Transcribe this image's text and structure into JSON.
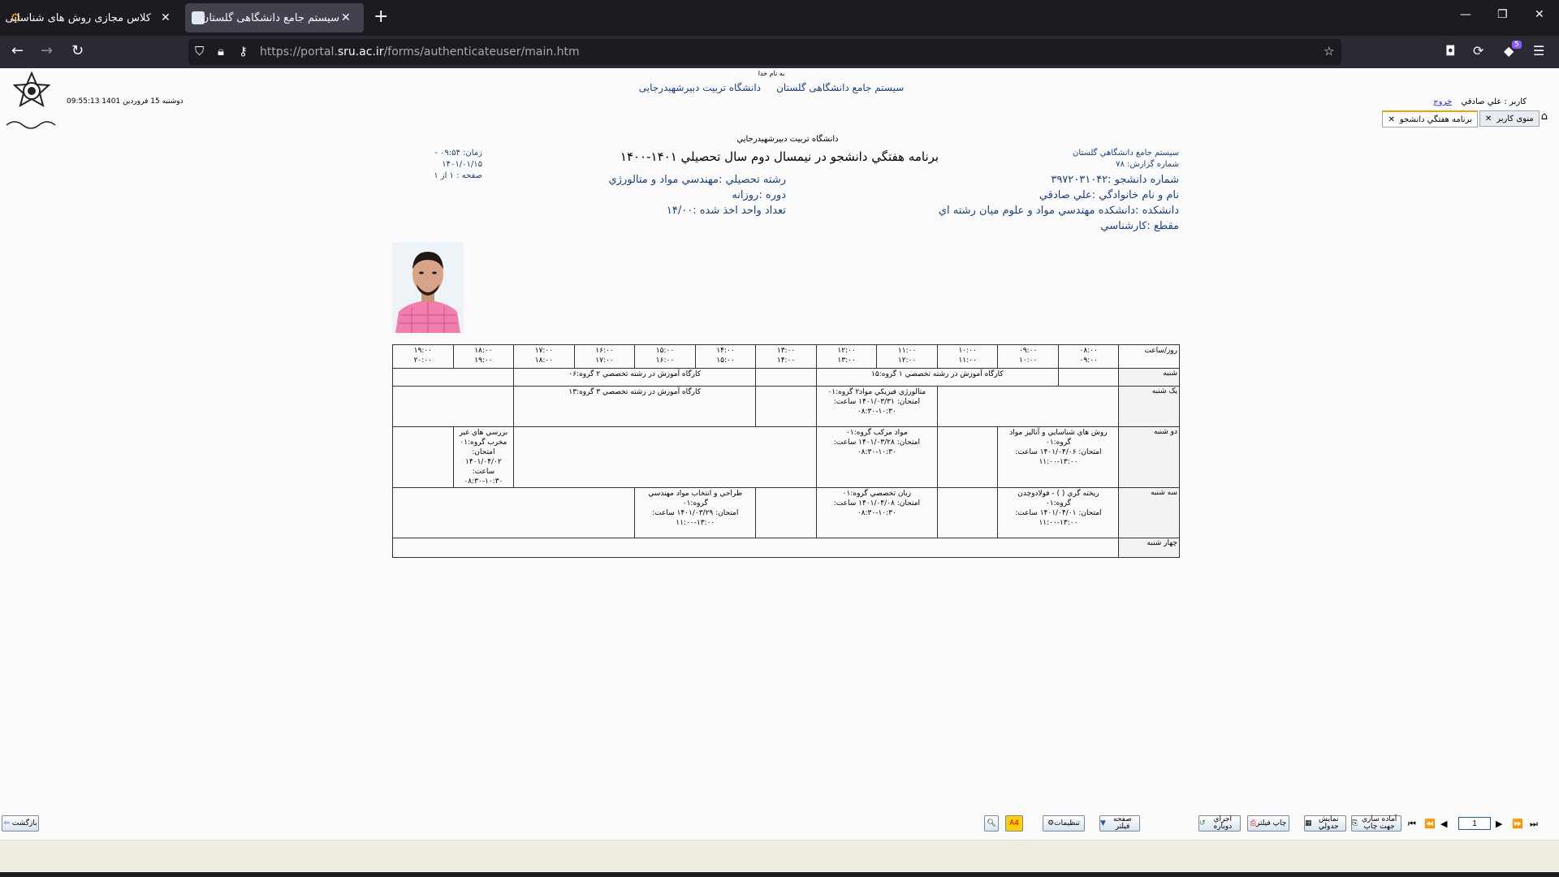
{
  "browser": {
    "tabs": [
      {
        "title": "کلاس مجازی روش های شناسایی",
        "active": false
      },
      {
        "title": "سیستم جامع دانشگاهی گلستان",
        "active": true
      }
    ],
    "url_prefix": "https://portal.",
    "url_domain": "sru.ac.ir",
    "url_path": "/forms/authenticateuser/main.htm",
    "extension_badge": "5"
  },
  "header": {
    "bismillah": "به نام خدا",
    "system_name": "سیستم جامع دانشگاهی گلستان",
    "university_name": "دانشگاه تربیت دبیرشهیدرجایی",
    "datetime": "09:55:13 دوشنبه 15 فروردین 1401",
    "user_label": "کاربر : علي صادقي",
    "exit_label": "خروج",
    "tabs": [
      {
        "label": "برنامه هفتگي دانشجو",
        "selected": true
      },
      {
        "label": "منوی کاربر",
        "selected": false
      }
    ]
  },
  "report": {
    "university": "دانشگاه تربيت دبيرشهيدرجايي",
    "title": "برنامه هفتگي دانشجو در نيمسال دوم سال تحصيلي ۱۴۰۱-۱۴۰۰",
    "time": "زمان: ۰۹:۵۴ - ۱۴۰۱/۰۱/۱۵",
    "page": "صفحه : ۱ از ۱",
    "system": "سيستم جامع دانشگاهي گلستان",
    "report_no": "شماره گزارش: ۷۸",
    "student_no": "شماره دانشجو :۳۹۷۲۰۳۱۰۴۲",
    "name": "نام و نام خانوادگي :علي صادقي",
    "faculty": "دانشکده :دانشکده مهندسي مواد و علوم ميان رشته اي",
    "level": "مقطع :کارشناسي",
    "field": "رشته تحصيلي :مهندسي مواد و متالورژي",
    "course_type": "دوره :روزانه",
    "units": "تعداد واحد اخذ شده :۱۴/۰۰"
  },
  "schedule": {
    "corner": "روز/ساعت",
    "hours": [
      [
        "۰۸:۰۰",
        "۰۹:۰۰"
      ],
      [
        "۰۹:۰۰",
        "۱۰:۰۰"
      ],
      [
        "۱۰:۰۰",
        "۱۱:۰۰"
      ],
      [
        "۱۱:۰۰",
        "۱۲:۰۰"
      ],
      [
        "۱۲:۰۰",
        "۱۳:۰۰"
      ],
      [
        "۱۳:۰۰",
        "۱۴:۰۰"
      ],
      [
        "۱۴:۰۰",
        "۱۵:۰۰"
      ],
      [
        "۱۵:۰۰",
        "۱۶:۰۰"
      ],
      [
        "۱۶:۰۰",
        "۱۷:۰۰"
      ],
      [
        "۱۷:۰۰",
        "۱۸:۰۰"
      ],
      [
        "۱۸:۰۰",
        "۱۹:۰۰"
      ],
      [
        "۱۹:۰۰",
        "۲۰:۰۰"
      ]
    ],
    "days": [
      {
        "name": "شنبه",
        "courses": [
          {
            "text": "کارگاه آموزش در رشته تخصصي ۱ گروه:۱۵"
          },
          {
            "text": "کارگاه آموزش در رشته تخصصي ۲ گروه:۰۶"
          }
        ]
      },
      {
        "name": "يک شنبه",
        "courses": [
          {
            "text": "متالورژي فيزيکي مواد۲ گروه:۰۱\nامتحان: ۱۴۰۱/۰۳/۳۱ ساعت:\n۰۸:۳۰-۱۰:۳۰"
          },
          {
            "text": "کارگاه آموزش در رشته تخصصي ۳ گروه:۱۳"
          }
        ]
      },
      {
        "name": "دو شنبه",
        "courses": [
          {
            "text": "روش هاي شناسايي و آناليز مواد\nگروه:۰۱\nامتحان: ۱۴۰۱/۰۴/۰۶ ساعت:\n۱۱:۰۰-۱۳:۰۰"
          },
          {
            "text": "مواد مرکب گروه:۰۱\nامتحان: ۱۴۰۱/۰۳/۲۸ ساعت:\n۰۸:۳۰-۱۰:۳۰"
          },
          {
            "text": "بررسي هاي غير مخرب گروه:۰۱\nامتحان: ۱۴۰۱/۰۴/۰۲ ساعت:\n۰۸:۳۰-۱۰:۳۰"
          }
        ]
      },
      {
        "name": "سه شنبه",
        "courses": [
          {
            "text": "ريخته گري ( ) - فولادوچدن\nگروه:۰۱\nامتحان: ۱۴۰۱/۰۴/۰۱ ساعت:\n۱۱:۰۰-۱۳:۰۰"
          },
          {
            "text": "زبان تخصصي گروه:۰۱\nامتحان: ۱۴۰۱/۰۴/۰۸ ساعت:\n۰۸:۳۰-۱۰:۳۰"
          },
          {
            "text": "طراحي و انتخاب مواد مهندسي\nگروه:۰۱\nامتحان: ۱۴۰۱/۰۳/۲۹ ساعت:\n۱۱:۰۰-۱۳:۰۰"
          }
        ]
      },
      {
        "name": "چهار شنبه",
        "courses": []
      }
    ]
  },
  "toolbar": {
    "back": "بازگشت",
    "settings": "تنظيمات",
    "page_filter": "صفحه فيلتر",
    "rerun": "اجراي دوباره",
    "print_filter": "چاپ فيلتر",
    "table_view": "نمايش جدولي",
    "prepare": "آماده سازي جهت چاپ",
    "paper": "A4",
    "page_number": "1"
  }
}
